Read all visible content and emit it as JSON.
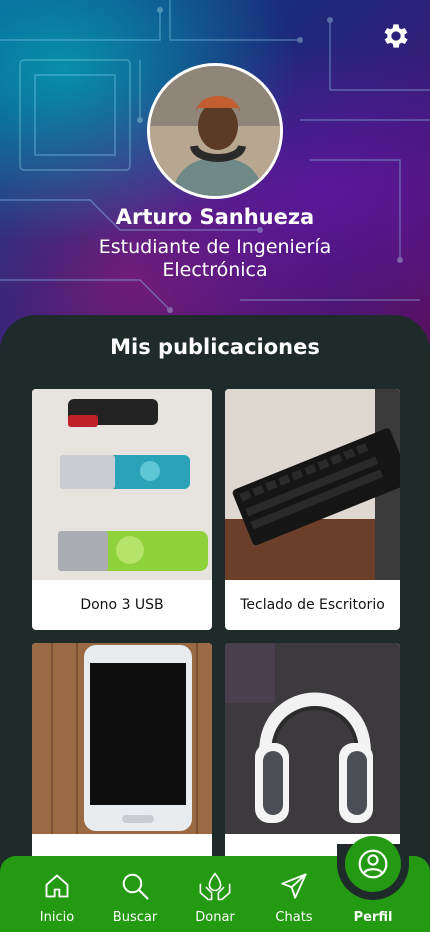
{
  "profile": {
    "name": "Arturo Sanhueza",
    "role": "Estudiante de Ingeniería Electrónica"
  },
  "section": {
    "title": "Mis publicaciones"
  },
  "publications": [
    {
      "label": "Dono 3 USB"
    },
    {
      "label": "Teclado de Escritorio"
    },
    {
      "label": ""
    },
    {
      "label": ""
    }
  ],
  "nav": {
    "items": [
      {
        "label": "Inicio",
        "icon": "home-icon"
      },
      {
        "label": "Buscar",
        "icon": "search-icon"
      },
      {
        "label": "Donar",
        "icon": "donate-icon"
      },
      {
        "label": "Chats",
        "icon": "send-icon"
      },
      {
        "label": "Perfil",
        "icon": "user-icon"
      }
    ],
    "active": "Perfil"
  },
  "colors": {
    "nav_green": "#249a12",
    "panel_bg": "#1f2a2b"
  }
}
